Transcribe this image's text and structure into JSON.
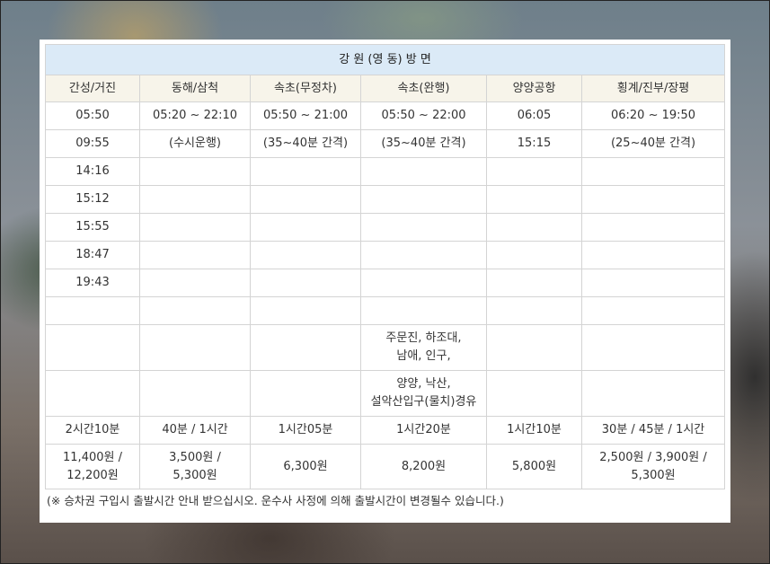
{
  "title": "강 원 (영 동) 방 면",
  "columns": [
    "간성/거진",
    "동해/삼척",
    "속초(무정차)",
    "속초(완행)",
    "양양공항",
    "횡계/진부/장평"
  ],
  "rows": [
    [
      "05:50",
      "05:20 ~ 22:10",
      "05:50 ~ 21:00",
      "05:50 ~ 22:00",
      "06:05",
      "06:20 ~ 19:50"
    ],
    [
      "09:55",
      "(수시운행)",
      "(35~40분 간격)",
      "(35~40분 간격)",
      "15:15",
      "(25~40분 간격)"
    ],
    [
      "14:16",
      "",
      "",
      "",
      "",
      ""
    ],
    [
      "15:12",
      "",
      "",
      "",
      "",
      ""
    ],
    [
      "15:55",
      "",
      "",
      "",
      "",
      ""
    ],
    [
      "18:47",
      "",
      "",
      "",
      "",
      ""
    ],
    [
      "19:43",
      "",
      "",
      "",
      "",
      ""
    ],
    [
      "",
      "",
      "",
      "",
      "",
      ""
    ]
  ],
  "via_rows": [
    [
      "",
      "",
      "",
      "주문진, 하조대,\n남애, 인구,",
      "",
      ""
    ],
    [
      "",
      "",
      "",
      "양양, 낙산,\n설악산입구(물치)경유",
      "",
      ""
    ]
  ],
  "duration": [
    "2시간10분",
    "40분 / 1시간",
    "1시간05분",
    "1시간20분",
    "1시간10분",
    "30분 / 45분 / 1시간"
  ],
  "fare": [
    "11,400원 /\n12,200원",
    "3,500원 /\n5,300원",
    "6,300원",
    "8,200원",
    "5,800원",
    "2,500원 / 3,900원 /\n5,300원"
  ],
  "note": "(※ 승차권 구입시 출발시간 안내 받으십시오. 운수사 사정에 의해 출발시간이 변경될수 있습니다.)"
}
